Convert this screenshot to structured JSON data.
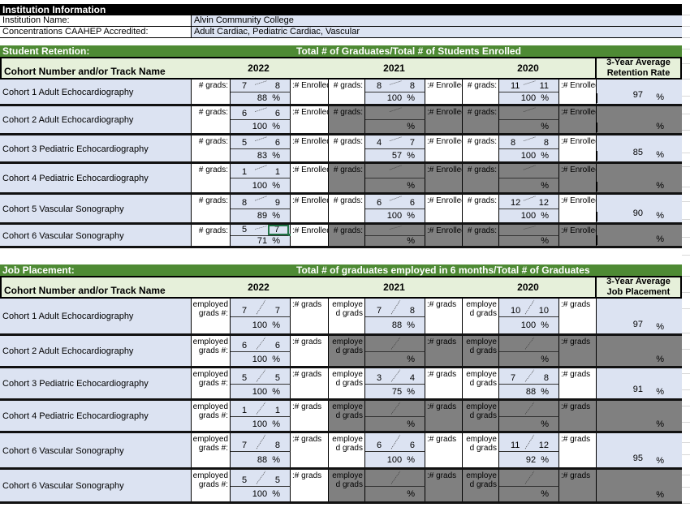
{
  "institution": {
    "title": "Institution Information",
    "name_label": "Institution Name:",
    "name_value": "Alvin Community College",
    "conc_label": "Concentrations CAAHEP Accredited:",
    "conc_value": "Adult Cardiac, Pediatric Cardiac, Vascular"
  },
  "retention": {
    "section_label": "Student Retention:",
    "section_title": "Total # of Graduates/Total # of Students Enrolled",
    "col_name": "Cohort Number and/or Track Name",
    "years": [
      "2022",
      "2021",
      "2020"
    ],
    "avg_header_1": "3-Year Average",
    "avg_header_2": "Retention Rate",
    "label_text": "# grads:",
    "suffix_text": ":# Enrolled",
    "pct_sign": "%",
    "rows": [
      {
        "name": "Cohort 1 Adult Echocardiography",
        "cells": [
          {
            "a": "7",
            "b": "8",
            "pct": "88",
            "gray": false
          },
          {
            "a": "8",
            "b": "8",
            "pct": "100",
            "gray": false
          },
          {
            "a": "11",
            "b": "11",
            "pct": "100",
            "gray": false
          }
        ],
        "avg": "97",
        "avg_gray": false
      },
      {
        "name": "Cohort 2 Adult Echocardiography",
        "cells": [
          {
            "a": "6",
            "b": "6",
            "pct": "100",
            "gray": false
          },
          {
            "a": "",
            "b": "",
            "pct": "",
            "gray": true
          },
          {
            "a": "",
            "b": "",
            "pct": "",
            "gray": true
          }
        ],
        "avg": "",
        "avg_gray": true
      },
      {
        "name": "Cohort 3 Pediatric Echocardiography",
        "cells": [
          {
            "a": "5",
            "b": "6",
            "pct": "83",
            "gray": false
          },
          {
            "a": "4",
            "b": "7",
            "pct": "57",
            "gray": false
          },
          {
            "a": "8",
            "b": "8",
            "pct": "100",
            "gray": false
          }
        ],
        "avg": "85",
        "avg_gray": false
      },
      {
        "name": "Cohort 4 Pediatric Echocardiography",
        "cells": [
          {
            "a": "1",
            "b": "1",
            "pct": "100",
            "gray": false
          },
          {
            "a": "",
            "b": "",
            "pct": "",
            "gray": true
          },
          {
            "a": "",
            "b": "",
            "pct": "",
            "gray": true
          }
        ],
        "avg": "",
        "avg_gray": true
      },
      {
        "name": "Cohort 5 Vascular Sonography",
        "cells": [
          {
            "a": "8",
            "b": "9",
            "pct": "89",
            "gray": false
          },
          {
            "a": "6",
            "b": "6",
            "pct": "100",
            "gray": false
          },
          {
            "a": "12",
            "b": "12",
            "pct": "100",
            "gray": false
          }
        ],
        "avg": "90",
        "avg_gray": false
      },
      {
        "name": "Cohort 6 Vascular Sonography",
        "cells": [
          {
            "a": "5",
            "b": "7",
            "pct": "71",
            "gray": false
          },
          {
            "a": "",
            "b": "",
            "pct": "",
            "gray": true
          },
          {
            "a": "",
            "b": "",
            "pct": "",
            "gray": true
          }
        ],
        "avg": "",
        "avg_gray": true
      }
    ]
  },
  "placement": {
    "section_label": "Job Placement:",
    "section_title": "Total # of graduates employed in 6 months/Total # of Graduates",
    "col_name": "Cohort Number and/or Track Name",
    "years": [
      "2022",
      "2021",
      "2020"
    ],
    "avg_header_1": "3-Year Average",
    "avg_header_2": "Job Placement",
    "label_2022_1": "employed",
    "label_2022_2": "grads #:",
    "label_other_1": "employe",
    "label_other_2": "d grads",
    "suffix_text": ":# grads",
    "pct_sign": "%",
    "rows": [
      {
        "name": "Cohort 1 Adult Echocardiography",
        "cells": [
          {
            "a": "7",
            "b": "7",
            "pct": "100",
            "gray": false
          },
          {
            "a": "7",
            "b": "8",
            "pct": "88",
            "gray": false
          },
          {
            "a": "10",
            "b": "10",
            "pct": "100",
            "gray": false
          }
        ],
        "avg": "97",
        "avg_gray": false
      },
      {
        "name": "Cohort 2 Adult Echocardiography",
        "cells": [
          {
            "a": "6",
            "b": "6",
            "pct": "100",
            "gray": false
          },
          {
            "a": "",
            "b": "",
            "pct": "",
            "gray": true
          },
          {
            "a": "",
            "b": "",
            "pct": "",
            "gray": true
          }
        ],
        "avg": "",
        "avg_gray": true
      },
      {
        "name": "Cohort 3 Pediatric Echocardiography",
        "cells": [
          {
            "a": "5",
            "b": "5",
            "pct": "100",
            "gray": false
          },
          {
            "a": "3",
            "b": "4",
            "pct": "75",
            "gray": false
          },
          {
            "a": "7",
            "b": "8",
            "pct": "88",
            "gray": false
          }
        ],
        "avg": "91",
        "avg_gray": false
      },
      {
        "name": "Cohort 4 Pediatric Echocardiography",
        "cells": [
          {
            "a": "1",
            "b": "1",
            "pct": "100",
            "gray": false
          },
          {
            "a": "",
            "b": "",
            "pct": "",
            "gray": true
          },
          {
            "a": "",
            "b": "",
            "pct": "",
            "gray": true
          }
        ],
        "avg": "",
        "avg_gray": true
      },
      {
        "name": "Cohort 6 Vascular Sonography",
        "cells": [
          {
            "a": "7",
            "b": "8",
            "pct": "88",
            "gray": false
          },
          {
            "a": "6",
            "b": "6",
            "pct": "100",
            "gray": false
          },
          {
            "a": "11",
            "b": "12",
            "pct": "92",
            "gray": false
          }
        ],
        "avg": "95",
        "avg_gray": false
      },
      {
        "name": "Cohort 6 Vascular Sonography",
        "cells": [
          {
            "a": "5",
            "b": "5",
            "pct": "100",
            "gray": false
          },
          {
            "a": "",
            "b": "",
            "pct": "",
            "gray": true
          },
          {
            "a": "",
            "b": "",
            "pct": "",
            "gray": true
          }
        ],
        "avg": "",
        "avg_gray": true
      }
    ]
  },
  "selection": {
    "cell": "retention-2022-row6-enrolled"
  }
}
